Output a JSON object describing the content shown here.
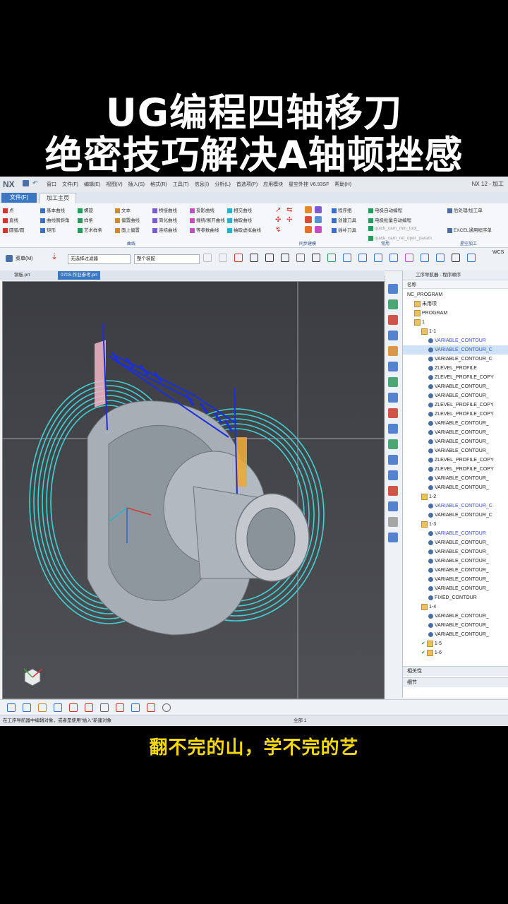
{
  "video": {
    "title_line1": "UG编程四轴移刀",
    "title_line2": "绝密技巧解决A轴顿挫感",
    "subtitle": "翻不完的山，学不完的艺"
  },
  "titlebar": {
    "logo": "NX",
    "menu": [
      "窗口",
      "文件(F)",
      "编辑(E)",
      "视图(V)",
      "插入(S)",
      "格式(R)",
      "工具(T)",
      "信息(I)",
      "分析(L)",
      "首选项(P)",
      "应用模块",
      "星空外挂 V6.93SF",
      "帮助(H)"
    ],
    "window_title": "NX 12 - 加工"
  },
  "tabs": {
    "file": "文件(F)",
    "home": "加工主页"
  },
  "ribbon": {
    "curve_group": {
      "items": [
        "点",
        "直线",
        "圆弧/圆",
        "基本曲线",
        "曲线倒斜角",
        "矩形",
        "螺旋",
        "样条",
        "艺术样条",
        "文本",
        "偏置曲线",
        "面上偏置",
        "桥接曲线",
        "简化曲线",
        "连结曲线",
        "投影曲线",
        "缠绕/展开曲线",
        "等参数曲线",
        "相交曲线",
        "抽取曲线",
        "抽取虚拟曲线"
      ],
      "label": "曲线"
    },
    "sync_group": {
      "label": "同步建模"
    },
    "tools_group": {
      "items": [
        "程序组",
        "创建刀具",
        "插补刀具",
        "电极自动编程",
        "电极批量自动编程",
        "quick_cam_min_tool_",
        "quick_cam_ret_oper_param"
      ],
      "label": "常用"
    },
    "post_group": {
      "items": [
        "后处理/加工单",
        "EXCEL通用程序单"
      ],
      "label": "星空加工"
    }
  },
  "toolbar": {
    "menu_button": "菜单(M)",
    "filter": "无选择过滤器",
    "assembly": "整个装配",
    "wcs": "WCS"
  },
  "file_tabs": [
    "铜板.prt",
    "0703-作业参考.prt"
  ],
  "navigator": {
    "header": "工序导航器 - 程序顺序",
    "column": "名称",
    "rows": [
      {
        "indent": 0,
        "text": "NC_PROGRAM",
        "type": "root"
      },
      {
        "indent": 1,
        "text": "未用项",
        "type": "folder"
      },
      {
        "indent": 1,
        "text": "PROGRAM",
        "type": "folder"
      },
      {
        "indent": 1,
        "text": "1",
        "type": "folder"
      },
      {
        "indent": 2,
        "text": "1-1",
        "type": "folder"
      },
      {
        "indent": 3,
        "text": "VARIABLE_CONTOUR",
        "type": "op-blue"
      },
      {
        "indent": 3,
        "text": "VARIABLE_CONTOUR_C",
        "type": "op-selected"
      },
      {
        "indent": 3,
        "text": "VARIABLE_CONTOUR_C",
        "type": "op"
      },
      {
        "indent": 3,
        "text": "ZLEVEL_PROFILE",
        "type": "op"
      },
      {
        "indent": 3,
        "text": "ZLEVEL_PROFILE_COPY",
        "type": "op"
      },
      {
        "indent": 3,
        "text": "VARIABLE_CONTOUR_",
        "type": "op"
      },
      {
        "indent": 3,
        "text": "VARIABLE_CONTOUR_",
        "type": "op"
      },
      {
        "indent": 3,
        "text": "ZLEVEL_PROFILE_COPY",
        "type": "op"
      },
      {
        "indent": 3,
        "text": "ZLEVEL_PROFILE_COPY",
        "type": "op"
      },
      {
        "indent": 3,
        "text": "VARIABLE_CONTOUR_",
        "type": "op"
      },
      {
        "indent": 3,
        "text": "VARIABLE_CONTOUR_",
        "type": "op"
      },
      {
        "indent": 3,
        "text": "VARIABLE_CONTOUR_",
        "type": "op"
      },
      {
        "indent": 3,
        "text": "VARIABLE_CONTOUR_",
        "type": "op"
      },
      {
        "indent": 3,
        "text": "ZLEVEL_PROFILE_COPY",
        "type": "op"
      },
      {
        "indent": 3,
        "text": "ZLEVEL_PROFILE_COPY",
        "type": "op"
      },
      {
        "indent": 3,
        "text": "VARIABLE_CONTOUR_",
        "type": "op"
      },
      {
        "indent": 3,
        "text": "VARIABLE_CONTOUR_",
        "type": "op"
      },
      {
        "indent": 2,
        "text": "1-2",
        "type": "folder"
      },
      {
        "indent": 3,
        "text": "VARIABLE_CONTOUR_C",
        "type": "op-blue"
      },
      {
        "indent": 3,
        "text": "VARIABLE_CONTOUR_C",
        "type": "op"
      },
      {
        "indent": 2,
        "text": "1-3",
        "type": "folder"
      },
      {
        "indent": 3,
        "text": "VARIABLE_CONTOUR",
        "type": "op-blue"
      },
      {
        "indent": 3,
        "text": "VARIABLE_CONTOUR_",
        "type": "op"
      },
      {
        "indent": 3,
        "text": "VARIABLE_CONTOUR_",
        "type": "op"
      },
      {
        "indent": 3,
        "text": "VARIABLE_CONTOUR_",
        "type": "op"
      },
      {
        "indent": 3,
        "text": "VARIABLE_CONTOUR_",
        "type": "op"
      },
      {
        "indent": 3,
        "text": "VARIABLE_CONTOUR_",
        "type": "op"
      },
      {
        "indent": 3,
        "text": "VARIABLE_CONTOUR_",
        "type": "op"
      },
      {
        "indent": 3,
        "text": "FIXED_CONTOUR",
        "type": "op"
      },
      {
        "indent": 2,
        "text": "1-4",
        "type": "folder"
      },
      {
        "indent": 3,
        "text": "VARIABLE_CONTOUR_",
        "type": "op"
      },
      {
        "indent": 3,
        "text": "VARIABLE_CONTOUR_",
        "type": "op"
      },
      {
        "indent": 3,
        "text": "VARIABLE_CONTOUR_",
        "type": "op"
      },
      {
        "indent": 2,
        "text": "1-5",
        "type": "folder-check"
      },
      {
        "indent": 2,
        "text": "1-6",
        "type": "folder-check"
      }
    ],
    "footer1": "相关性",
    "footer2": "细节"
  },
  "status": {
    "prompt": "在工序导航器中编辑对象，或者是使用\"插入\"新建对象",
    "mode": "全部 1"
  },
  "colors": {
    "toolpath_cyan": "#3fd2d8",
    "toolpath_blue": "#1b2fe0",
    "part_gray": "#9ea6ae",
    "subtitle_yellow": "#f5d90a",
    "accent_blue": "#3b78c4"
  }
}
